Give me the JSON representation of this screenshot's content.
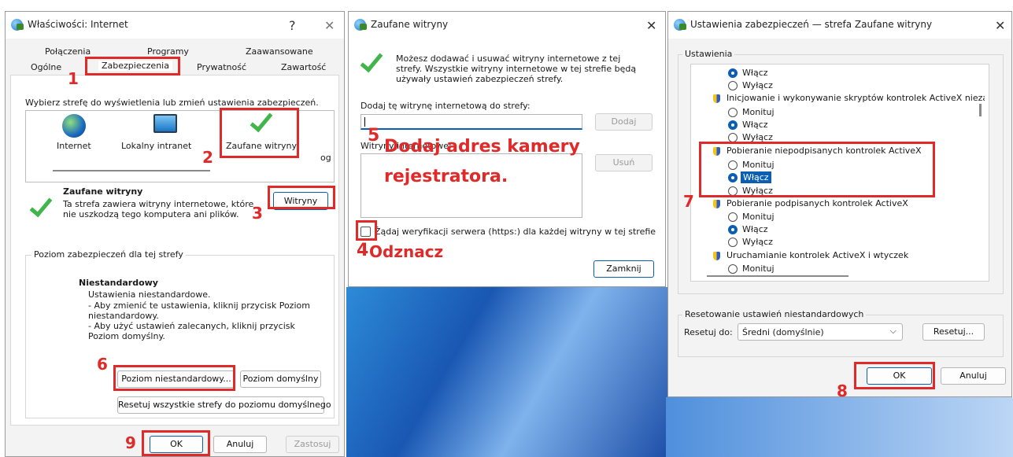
{
  "colors": {
    "accent": "#0a5fb4",
    "annotation": "#e02a2a",
    "check": "#3fb54a"
  },
  "annotations": {
    "n1": "1",
    "n2": "2",
    "n3": "3",
    "n4": "4",
    "n4_text": "Odznacz",
    "n5": "5",
    "n5_text_line1": "Dodaj adres kamery",
    "n5_text_line2": "rejestratora.",
    "n6": "6",
    "n7": "7",
    "n8": "8",
    "n9": "9"
  },
  "internet_props": {
    "title": "Właściwości: Internet",
    "help": "?",
    "close": "✕",
    "tabs_row1": [
      "Połączenia",
      "Programy",
      "Zaawansowane"
    ],
    "tabs_row2": [
      "Ogólne",
      "Zabezpieczenia",
      "Prywatność",
      "Zawartość"
    ],
    "zone_prompt": "Wybierz strefę do wyświetlenia lub zmień ustawienia zabezpieczeń.",
    "zones": [
      "Internet",
      "Lokalny intranet",
      "Zaufane witryny",
      "og"
    ],
    "zone_title": "Zaufane witryny",
    "zone_desc": "Ta strefa zawiera witryny internetowe, które nie uszkodzą tego komputera ani plików.",
    "sites_button": "Witryny",
    "level_group": "Poziom zabezpieczeń dla tej strefy",
    "level_title": "Niestandardowy",
    "level_lines": [
      "Ustawienia niestandardowe.",
      "- Aby zmienić te ustawienia, kliknij przycisk Poziom niestandardowy.",
      "- Aby użyć ustawień zalecanych, kliknij przycisk Poziom domyślny."
    ],
    "custom_level_button": "Poziom niestandardowy...",
    "default_level_button": "Poziom domyślny",
    "reset_all_button": "Resetuj wszystkie strefy do poziomu domyślnego",
    "ok": "OK",
    "cancel": "Anuluj",
    "apply": "Zastosuj"
  },
  "trusted_sites": {
    "title": "Zaufane witryny",
    "close": "✕",
    "info": "Możesz dodawać i usuwać witryny internetowe z tej strefy. Wszystkie witryny internetowe w tej strefie będą używały ustawień zabezpieczeń strefy.",
    "add_label": "Dodaj tę witrynę internetową do strefy:",
    "add_input_value": "",
    "add_button": "Dodaj",
    "websites_label": "Witryny internetowe:",
    "remove_button": "Usuń",
    "https_checkbox": "Żądaj weryfikacji serwera (https:) dla każdej witryny w tej strefie",
    "https_checked": false,
    "close_button": "Zamknij"
  },
  "security_settings": {
    "title": "Ustawienia zabezpieczeń — strefa Zaufane witryny",
    "close": "✕",
    "settings_label": "Ustawienia",
    "items": [
      {
        "type": "radio",
        "label": "Włącz",
        "checked": true
      },
      {
        "type": "radio",
        "label": "Wyłącz",
        "checked": false
      },
      {
        "type": "header",
        "label": "Inicjowanie i wykonywanie skryptów kontrolek ActiveX niezaznaczonych"
      },
      {
        "type": "radio",
        "label": "Monituj",
        "checked": false
      },
      {
        "type": "radio",
        "label": "Włącz",
        "checked": true
      },
      {
        "type": "radio",
        "label": "Wyłącz",
        "checked": false
      },
      {
        "type": "header",
        "label": "Pobieranie niepodpisanych kontrolek ActiveX"
      },
      {
        "type": "radio",
        "label": "Monituj",
        "checked": false
      },
      {
        "type": "radio",
        "label": "Włącz",
        "checked": true,
        "selected": true
      },
      {
        "type": "radio",
        "label": "Wyłącz",
        "checked": false
      },
      {
        "type": "header",
        "label": "Pobieranie podpisanych kontrolek ActiveX"
      },
      {
        "type": "radio",
        "label": "Monituj",
        "checked": false
      },
      {
        "type": "radio",
        "label": "Włącz",
        "checked": true
      },
      {
        "type": "radio",
        "label": "Wyłącz",
        "checked": false
      },
      {
        "type": "header",
        "label": "Uruchamianie kontrolek ActiveX i wtyczek"
      },
      {
        "type": "radio",
        "label": "Monituj",
        "checked": false
      }
    ],
    "reset_group": "Resetowanie ustawień niestandardowych",
    "reset_to_label": "Resetuj do:",
    "reset_select": "Średni (domyślnie)",
    "reset_button": "Resetuj...",
    "ok": "OK",
    "cancel": "Anuluj"
  }
}
